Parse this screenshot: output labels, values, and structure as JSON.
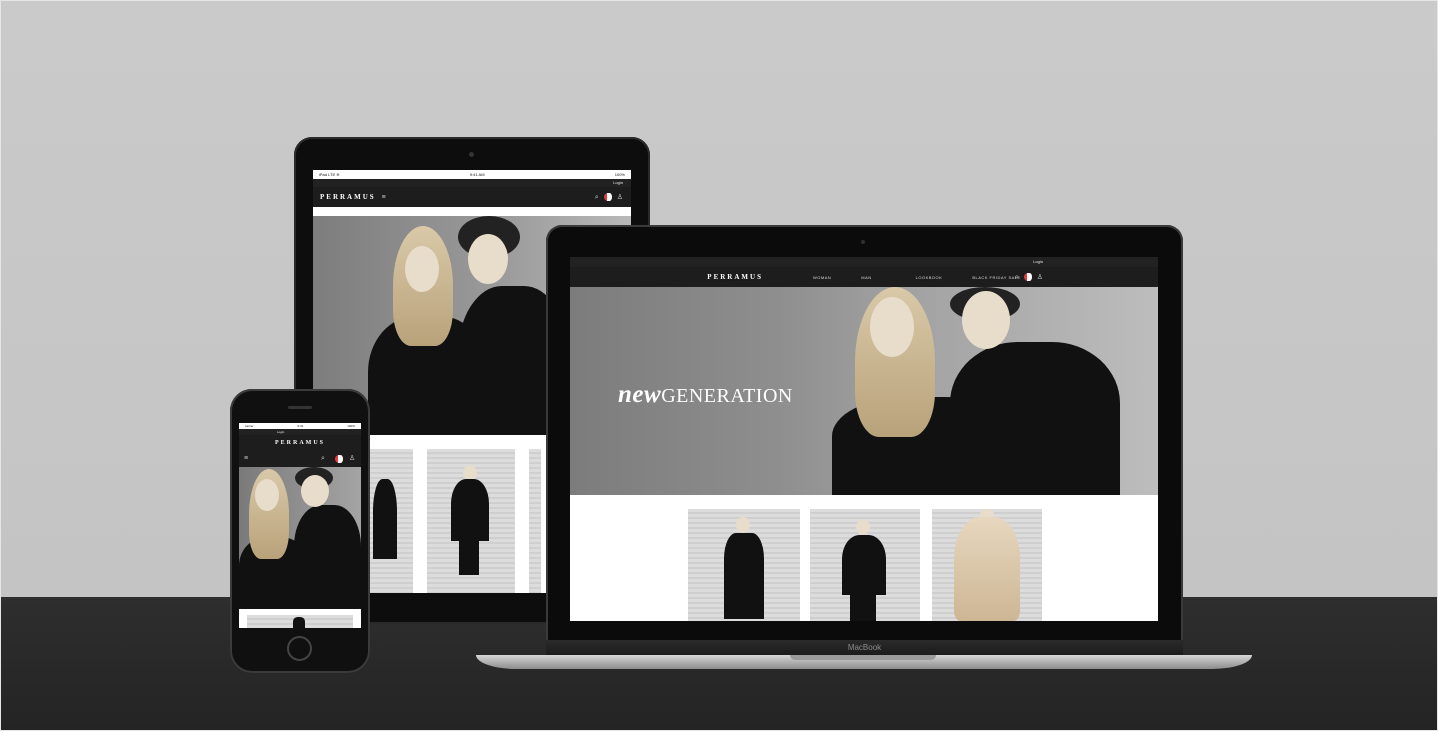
{
  "brand": {
    "logo": "PERRAMUS"
  },
  "ipad": {
    "status_left": "iPad LTE ≋",
    "status_time": "9:41 AM",
    "status_right": "100%",
    "top_link": "Login"
  },
  "macbook": {
    "top_link": "Login",
    "nav": [
      "WOMAN",
      "MAN",
      "LOOKBOOK",
      "BLACK FRIDAY SALE"
    ],
    "hero_new": "new",
    "hero_generation": "GENERATION",
    "device_label": "MacBook"
  },
  "iphone": {
    "status_left": "carrier",
    "status_time": "9:41",
    "status_right": "100%",
    "top_link": "Login"
  },
  "icons": [
    "search-icon",
    "shopping-bag-icon",
    "user-icon",
    "menu-icon"
  ],
  "colors": {
    "wall": "#c8c8c8",
    "desk": "#2a2a2a",
    "navbar": "#1d1d1d",
    "bag": "#e43a3a"
  }
}
